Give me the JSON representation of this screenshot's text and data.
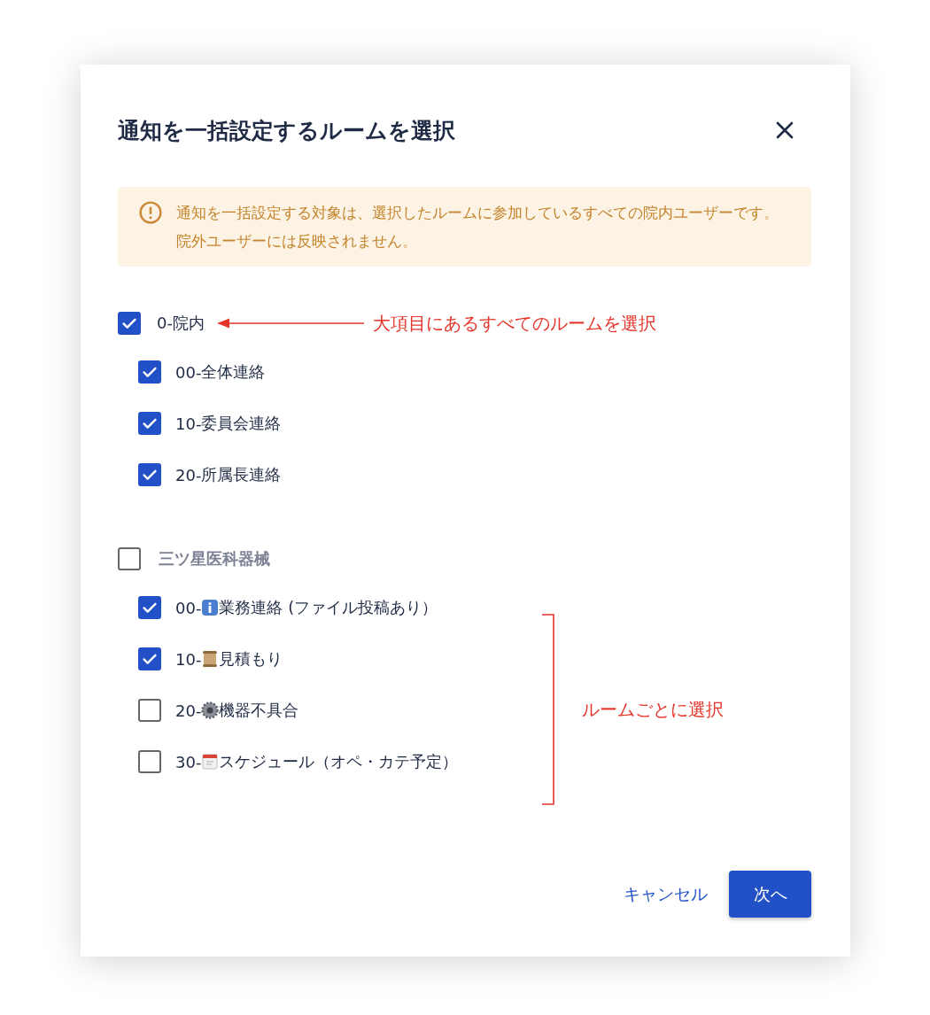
{
  "dialog": {
    "title": "通知を一括設定するルームを選択"
  },
  "notice": {
    "text": "通知を一括設定する対象は、選択したルームに参加しているすべての院内ユーザーです。院外ユーザーには反映されません。"
  },
  "groups": [
    {
      "label": "0-院内",
      "checked": true,
      "annotation": {
        "kind": "arrow",
        "text": "大項目にあるすべてのルームを選択"
      },
      "rooms": [
        {
          "prefix": "00-",
          "name": "全体連絡",
          "kind": "plain",
          "checked": true
        },
        {
          "prefix": "10-",
          "name": "委員会連絡",
          "kind": "plain",
          "checked": true
        },
        {
          "prefix": "20-",
          "name": "所属長連絡",
          "kind": "plain",
          "checked": true
        }
      ]
    },
    {
      "label": "三ツ星医科器械",
      "checked": false,
      "annotation": {
        "kind": "bracket",
        "text": "ルームごとに選択"
      },
      "rooms": [
        {
          "prefix": "00-",
          "name": "業務連絡 (ファイル投稿あり）",
          "kind": "info",
          "checked": true
        },
        {
          "prefix": "10-",
          "name": "見積もり",
          "kind": "scroll",
          "checked": true
        },
        {
          "prefix": "20-",
          "name": "機器不具合",
          "kind": "gear",
          "checked": false
        },
        {
          "prefix": "30-",
          "name": "スケジュール（オペ・カテ予定）",
          "kind": "calendar",
          "checked": false
        }
      ]
    }
  ],
  "buttons": {
    "cancel": "キャンセル",
    "next": "次へ"
  }
}
